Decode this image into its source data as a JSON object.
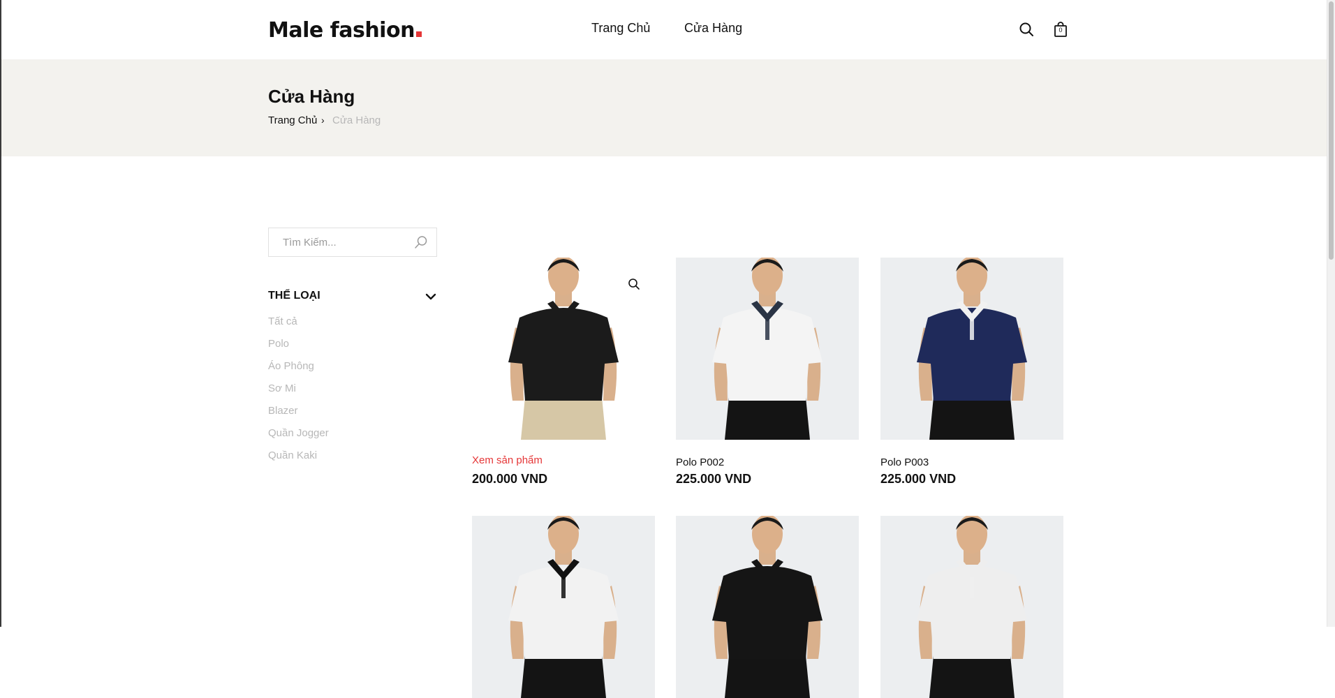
{
  "header": {
    "logo": "Male fashion",
    "nav": {
      "home": "Trang Chủ",
      "shop": "Cửa Hàng"
    },
    "cart_count": "0",
    "icons": [
      "search-icon",
      "shopping-bag-icon"
    ],
    "accent_color": "#e53637"
  },
  "banner": {
    "title": "Cửa Hàng",
    "breadcrumb": {
      "home": "Trang Chủ",
      "separator": "›",
      "current": "Cửa Hàng"
    }
  },
  "sidebar": {
    "search_placeholder": "Tìm Kiếm...",
    "category_title": "Thể loại",
    "categories": [
      "Tất cả",
      "Polo",
      "Áo Phông",
      "Sơ Mi",
      "Blazer",
      "Quần Jogger",
      "Quần Kaki"
    ]
  },
  "products": [
    {
      "name": "Xem sản phẩm",
      "price": "200.000 VND",
      "shirt": "#1b1b1b",
      "pants": "#d6c7a6",
      "collar": "#1b1b1b",
      "state": "hover"
    },
    {
      "name": "Polo P002",
      "price": "225.000 VND",
      "shirt": "#f4f4f4",
      "pants": "#141414",
      "collar": "#2a3445"
    },
    {
      "name": "Polo P003",
      "price": "225.000 VND",
      "shirt": "#1f2a5a",
      "pants": "#141414",
      "collar": "#f1f1f1"
    },
    {
      "name": "",
      "price": "",
      "shirt": "#f2f2f2",
      "pants": "#141414",
      "collar": "#111111"
    },
    {
      "name": "",
      "price": "",
      "shirt": "#151515",
      "pants": "#141414",
      "collar": "#151515"
    },
    {
      "name": "",
      "price": "",
      "shirt": "#eeeeee",
      "pants": "#141414",
      "collar": "#eeeeee"
    }
  ]
}
